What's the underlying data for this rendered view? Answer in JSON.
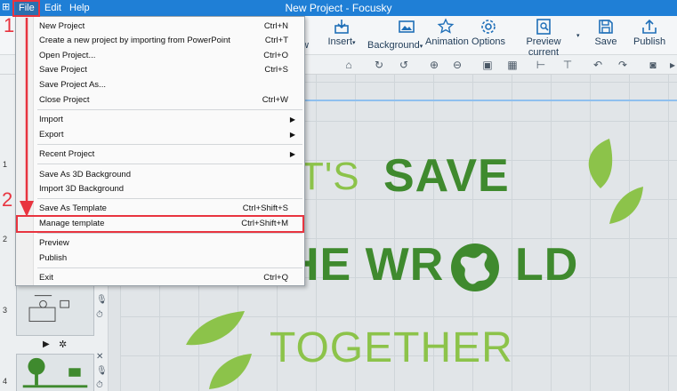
{
  "window": {
    "title": "New Project - Focusky"
  },
  "menubar": {
    "file": "File",
    "edit": "Edit",
    "help": "Help"
  },
  "toolbar": {
    "partial_left": "w",
    "insert": "Insert",
    "background": "Background",
    "animation": "Animation",
    "options": "Options",
    "preview": "Preview current",
    "save": "Save",
    "publish": "Publish"
  },
  "file_menu": {
    "items": [
      {
        "label": "New Project",
        "shortcut": "Ctrl+N"
      },
      {
        "label": "Create a new project by importing from PowerPoint",
        "shortcut": "Ctrl+T"
      },
      {
        "label": "Open Project...",
        "shortcut": "Ctrl+O"
      },
      {
        "label": "Save Project",
        "shortcut": "Ctrl+S"
      },
      {
        "label": "Save Project As...",
        "shortcut": ""
      },
      {
        "label": "Close Project",
        "shortcut": "Ctrl+W"
      },
      {
        "label": "Import",
        "shortcut": ""
      },
      {
        "label": "Export",
        "shortcut": ""
      },
      {
        "label": "Recent Project",
        "shortcut": ""
      },
      {
        "label": "Save As 3D Background",
        "shortcut": ""
      },
      {
        "label": "Import 3D Background",
        "shortcut": ""
      },
      {
        "label": "Save As Template",
        "shortcut": "Ctrl+Shift+S"
      },
      {
        "label": "Manage template",
        "shortcut": "Ctrl+Shift+M"
      },
      {
        "label": "Preview",
        "shortcut": ""
      },
      {
        "label": "Publish",
        "shortcut": ""
      },
      {
        "label": "Exit",
        "shortcut": "Ctrl+Q"
      }
    ]
  },
  "slides": {
    "n1": "1",
    "n2": "2",
    "n3": "3",
    "n4": "4"
  },
  "canvas": {
    "line1_light": "T'S",
    "line1_bold": "SAVE",
    "line2_left": "HE WR",
    "line2_right": "LD",
    "line3": "TOGETHER"
  },
  "annotations": {
    "step1": "1",
    "step2": "2"
  },
  "colors": {
    "accent": "#1f7fd6",
    "highlight": "#e8343f",
    "green": "#3f8a2e"
  }
}
